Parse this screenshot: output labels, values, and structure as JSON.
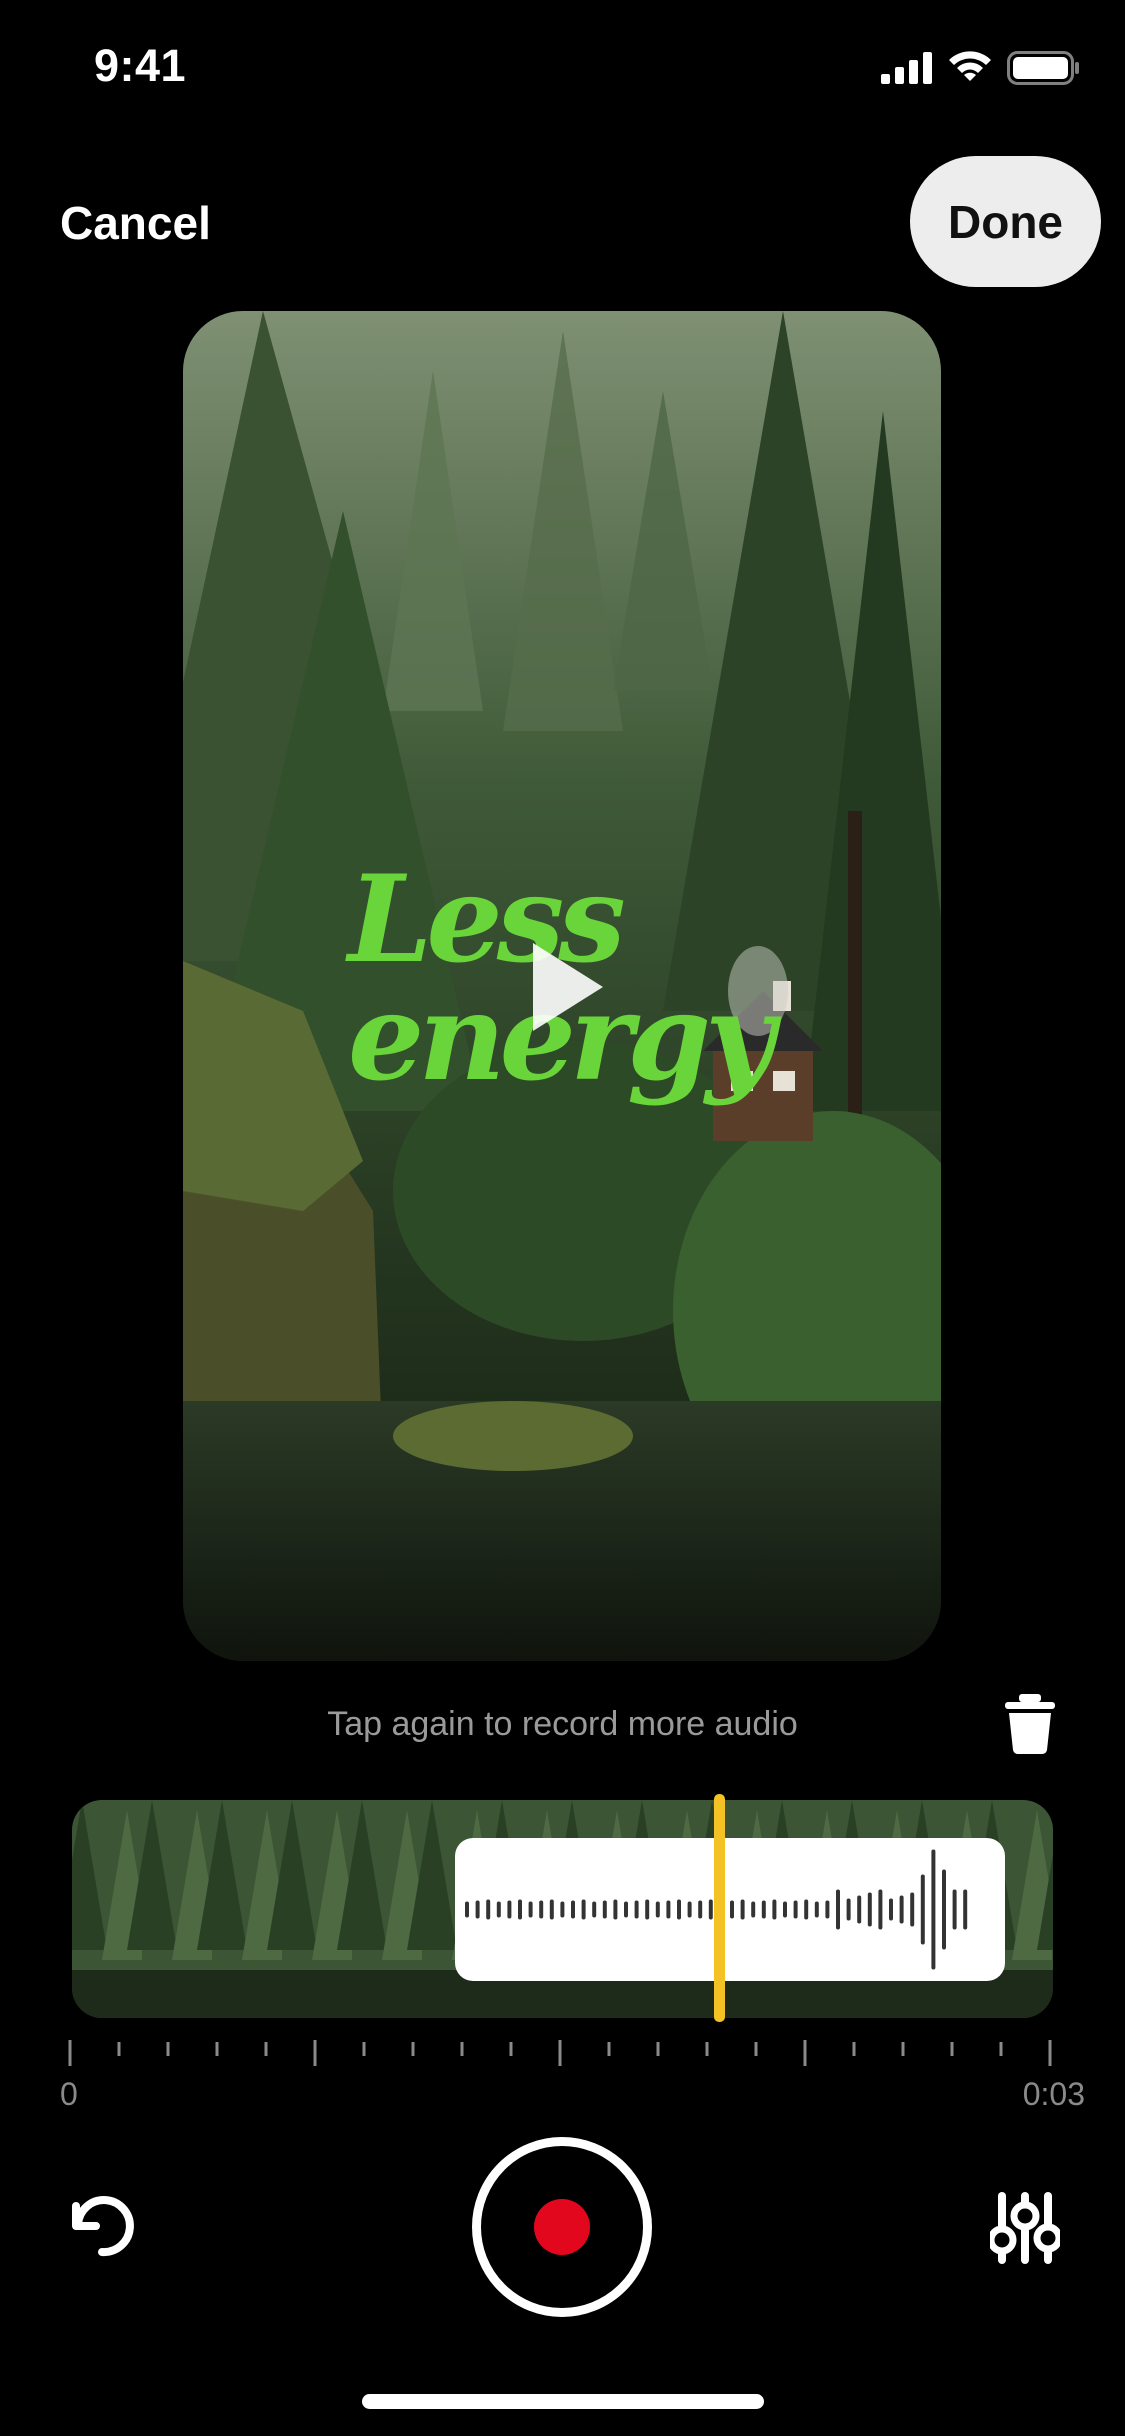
{
  "status_bar": {
    "time": "9:41",
    "icons": [
      "signal-icon",
      "wifi-icon",
      "battery-icon"
    ]
  },
  "nav": {
    "cancel_label": "Cancel",
    "done_label": "Done"
  },
  "video": {
    "overlay_lines": [
      "Less",
      "energy"
    ],
    "overlay_color": "#6ad53a",
    "play_icon": "play-icon"
  },
  "recording": {
    "hint": "Tap again to record more audio",
    "delete_icon": "trash-icon"
  },
  "timeline": {
    "start_label": "0",
    "end_label": "0:03",
    "playhead_color": "#f5c226"
  },
  "controls": {
    "undo_icon": "undo-icon",
    "record_icon": "record-icon",
    "record_color": "#e3071e",
    "adjust_icon": "sliders-icon"
  }
}
